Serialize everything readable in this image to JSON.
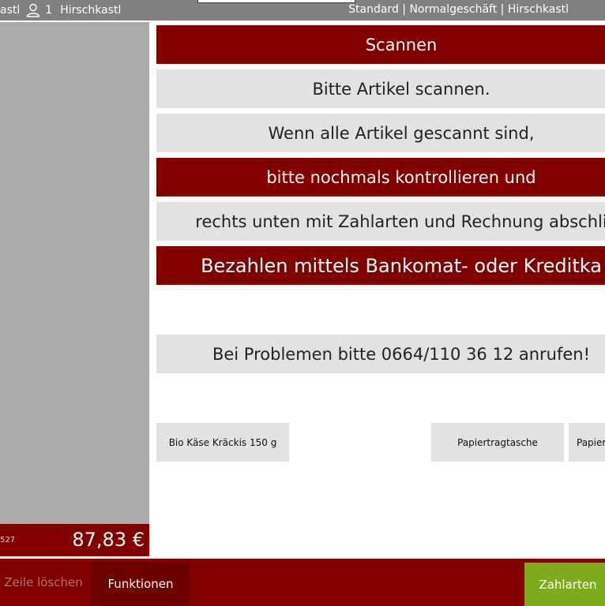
{
  "topbar": {
    "cashier_tail": "astl",
    "user_number": "1",
    "user_name": "Hirschkastl",
    "context": "Standard | Normalgeschäft | Hirschkastl"
  },
  "receipt": {
    "count_fragment": "527",
    "total": "87,83 €"
  },
  "messages": [
    "Scannen",
    "Bitte Artikel scannen.",
    "Wenn alle Artikel gescannt sind,",
    "bitte nochmals kontrollieren und",
    "rechts unten mit Zahlarten und Rechnung abschli",
    "Bezahlen mittels Bankomat- oder Kreditka",
    "Bei Problemen bitte 0664/110 36 12 anrufen!"
  ],
  "quick_articles": [
    "Bio Käse Kräckis 150 g",
    "Papiertragtasche",
    "Papier"
  ],
  "actions": {
    "delete_line": "Zeile löschen",
    "functions": "Funktionen",
    "payment_methods": "Zahlarten"
  },
  "colors": {
    "brand_red": "#800000",
    "pay_green": "#7cab1f"
  }
}
